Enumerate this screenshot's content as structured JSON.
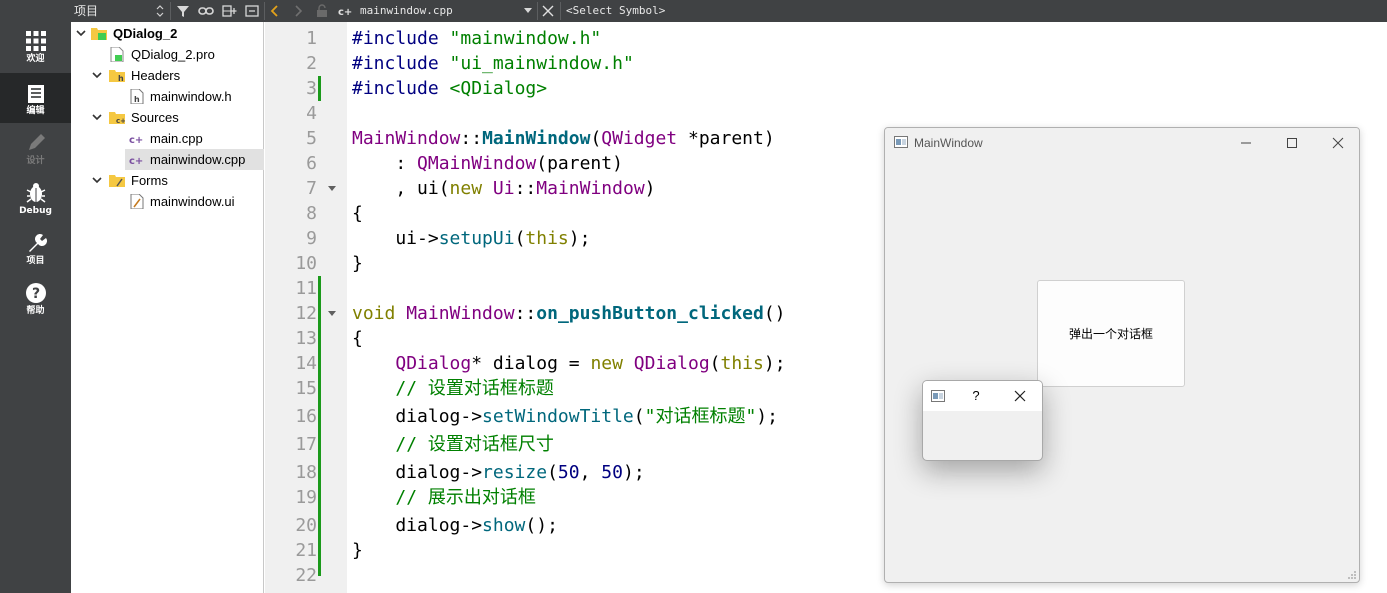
{
  "toolbar": {
    "panel_title": "项目",
    "file_name": "mainwindow.cpp",
    "symbol_placeholder": "<Select Symbol>"
  },
  "modes": [
    {
      "label": "欢迎",
      "icon": "grid-icon",
      "state": "normal"
    },
    {
      "label": "编辑",
      "icon": "document-icon",
      "state": "active"
    },
    {
      "label": "设计",
      "icon": "pen-icon",
      "state": "disabled"
    },
    {
      "label": "Debug",
      "icon": "bug-icon",
      "state": "normal"
    },
    {
      "label": "项目",
      "icon": "wrench-icon",
      "state": "normal"
    },
    {
      "label": "帮助",
      "icon": "help-icon",
      "state": "normal"
    }
  ],
  "tree": {
    "project": "QDialog_2",
    "pro_file": "QDialog_2.pro",
    "headers_label": "Headers",
    "header_file": "mainwindow.h",
    "sources_label": "Sources",
    "source_files": [
      "main.cpp",
      "mainwindow.cpp"
    ],
    "selected_file": "mainwindow.cpp",
    "forms_label": "Forms",
    "form_file": "mainwindow.ui"
  },
  "editor": {
    "line_numbers": [
      "1",
      "2",
      "3",
      "4",
      "5",
      "6",
      "7",
      "8",
      "9",
      "10",
      "11",
      "12",
      "13",
      "14",
      "15",
      "16",
      "17",
      "18",
      "19",
      "20",
      "21",
      "22"
    ],
    "lines": [
      [
        [
          "pp",
          "#include "
        ],
        [
          "str",
          "\"mainwindow.h\""
        ]
      ],
      [
        [
          "pp",
          "#include "
        ],
        [
          "str",
          "\"ui_mainwindow.h\""
        ]
      ],
      [
        [
          "pp",
          "#include "
        ],
        [
          "str",
          "<QDialog>"
        ]
      ],
      [],
      [
        [
          "ty",
          "MainWindow"
        ],
        [
          "",
          "::"
        ],
        [
          "fnb",
          "MainWindow"
        ],
        [
          "",
          "("
        ],
        [
          "ty",
          "QWidget"
        ],
        [
          "",
          " *parent)"
        ]
      ],
      [
        [
          "",
          "    : "
        ],
        [
          "ty",
          "QMainWindow"
        ],
        [
          "",
          "(parent)"
        ]
      ],
      [
        [
          "",
          "    , ui("
        ],
        [
          "kw",
          "new"
        ],
        [
          "",
          " "
        ],
        [
          "ty",
          "Ui"
        ],
        [
          "",
          "::"
        ],
        [
          "ty",
          "MainWindow"
        ],
        [
          "",
          ")"
        ]
      ],
      [
        [
          "",
          "{"
        ]
      ],
      [
        [
          "",
          "    ui->"
        ],
        [
          "fn",
          "setupUi"
        ],
        [
          "",
          "("
        ],
        [
          "kw",
          "this"
        ],
        [
          "",
          ");"
        ]
      ],
      [
        [
          "",
          "}"
        ]
      ],
      [],
      [
        [
          "kw",
          "void"
        ],
        [
          "",
          " "
        ],
        [
          "ty",
          "MainWindow"
        ],
        [
          "",
          "::"
        ],
        [
          "fnb",
          "on_pushButton_clicked"
        ],
        [
          "",
          "()"
        ]
      ],
      [
        [
          "",
          "{"
        ]
      ],
      [
        [
          "",
          "    "
        ],
        [
          "ty",
          "QDialog"
        ],
        [
          "",
          "* dialog = "
        ],
        [
          "kw",
          "new"
        ],
        [
          "",
          " "
        ],
        [
          "ty",
          "QDialog"
        ],
        [
          "",
          "("
        ],
        [
          "kw",
          "this"
        ],
        [
          "",
          ");"
        ]
      ],
      [
        [
          "",
          "    "
        ],
        [
          "cm",
          "// 设置对话框标题"
        ]
      ],
      [
        [
          "",
          "    dialog->"
        ],
        [
          "fn",
          "setWindowTitle"
        ],
        [
          "",
          "("
        ],
        [
          "str",
          "\"对话框标题\""
        ],
        [
          "",
          ");"
        ]
      ],
      [
        [
          "",
          "    "
        ],
        [
          "cm",
          "// 设置对话框尺寸"
        ]
      ],
      [
        [
          "",
          "    dialog->"
        ],
        [
          "fn",
          "resize"
        ],
        [
          "",
          "("
        ],
        [
          "num",
          "50"
        ],
        [
          "",
          ", "
        ],
        [
          "num",
          "50"
        ],
        [
          "",
          ");"
        ]
      ],
      [
        [
          "",
          "    "
        ],
        [
          "cm",
          "// 展示出对话框"
        ]
      ],
      [
        [
          "",
          "    dialog->"
        ],
        [
          "fn",
          "show"
        ],
        [
          "",
          "();"
        ]
      ],
      [
        [
          "",
          "}"
        ]
      ],
      []
    ]
  },
  "main_window": {
    "title": "MainWindow",
    "button_label": "弹出一个对话框"
  },
  "dialog": {
    "help_label": "?"
  }
}
